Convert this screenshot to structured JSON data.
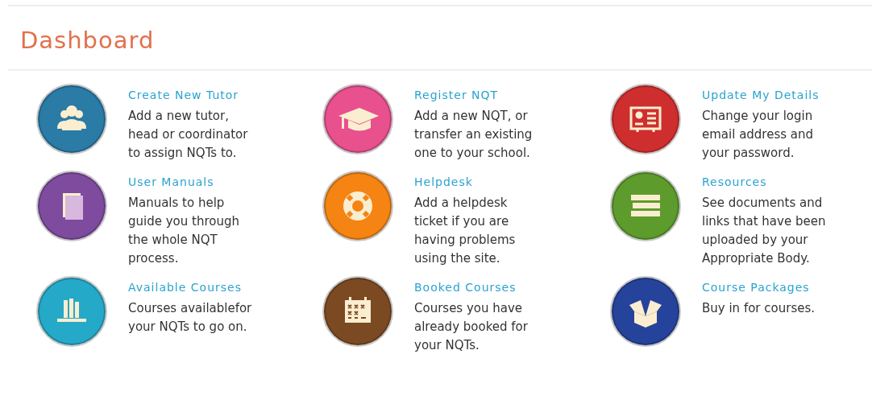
{
  "title": "Dashboard",
  "items": [
    {
      "title": "Create New Tutor",
      "description": "Add a new tutor,\nhead or coordinator\nto assign NQTs to.",
      "kind": "people",
      "color": "#2a7ba6"
    },
    {
      "title": "Register NQT",
      "description": "Add a new NQT, or\ntransfer an existing\none to your school.",
      "kind": "cap",
      "color": "#e8508e"
    },
    {
      "title": "Update My Details",
      "description": "Change your login\nemail address and\nyour password.",
      "kind": "card",
      "color": "#cf2e2e"
    },
    {
      "title": "User Manuals",
      "description": "Manuals to help\nguide you through\nthe whole NQT\nprocess.",
      "kind": "book",
      "color": "#7e4b9f"
    },
    {
      "title": "Helpdesk",
      "description": "Add a helpdesk\nticket if you are\nhaving problems\nusing the site.",
      "kind": "lifebuoy",
      "color": "#f58413"
    },
    {
      "title": "Resources",
      "description": "See documents and\nlinks that have been\nuploaded by your\nAppropriate Body.",
      "kind": "stack",
      "color": "#5c9b2c"
    },
    {
      "title": "Available Courses",
      "description": "Courses availablefor\nyour NQTs to go on.",
      "kind": "shelf",
      "color": "#25a9c8"
    },
    {
      "title": "Booked Courses",
      "description": "Courses you have\nalready booked for\nyour NQTs.",
      "kind": "calendar",
      "color": "#7b4a22"
    },
    {
      "title": "Course Packages",
      "description": "Buy in for courses.",
      "kind": "box",
      "color": "#26439c"
    }
  ]
}
